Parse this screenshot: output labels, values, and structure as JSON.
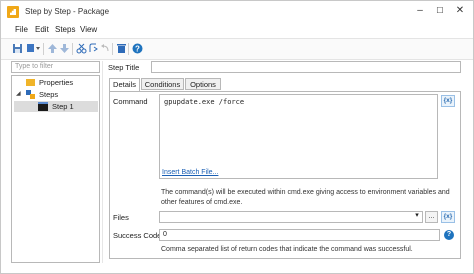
{
  "window": {
    "title": "Step by Step - Package",
    "controls": [
      "–",
      "☐",
      "✕"
    ]
  },
  "menu": [
    "File",
    "Edit",
    "Steps",
    "View"
  ],
  "filter": {
    "placeholder": "Type to filter"
  },
  "tree": {
    "items": [
      "Properties",
      "Steps",
      "Step 1"
    ]
  },
  "step_title": {
    "label": "Step Title",
    "value": ""
  },
  "tabs": [
    "Details",
    "Conditions",
    "Options"
  ],
  "command": {
    "label": "Command",
    "value": "gpupdate.exe /force",
    "insert_link": "Insert Batch File...",
    "variable_btn": "{x}",
    "note": "The command(s) will be executed within cmd.exe giving access to environment variables and other features of cmd.exe."
  },
  "files": {
    "label": "Files",
    "value": "",
    "browse_btn": "...",
    "variable_btn": "{x}"
  },
  "success": {
    "label": "Success Codes",
    "value": "0",
    "note": "Comma separated list of return codes that indicate the command was successful."
  }
}
